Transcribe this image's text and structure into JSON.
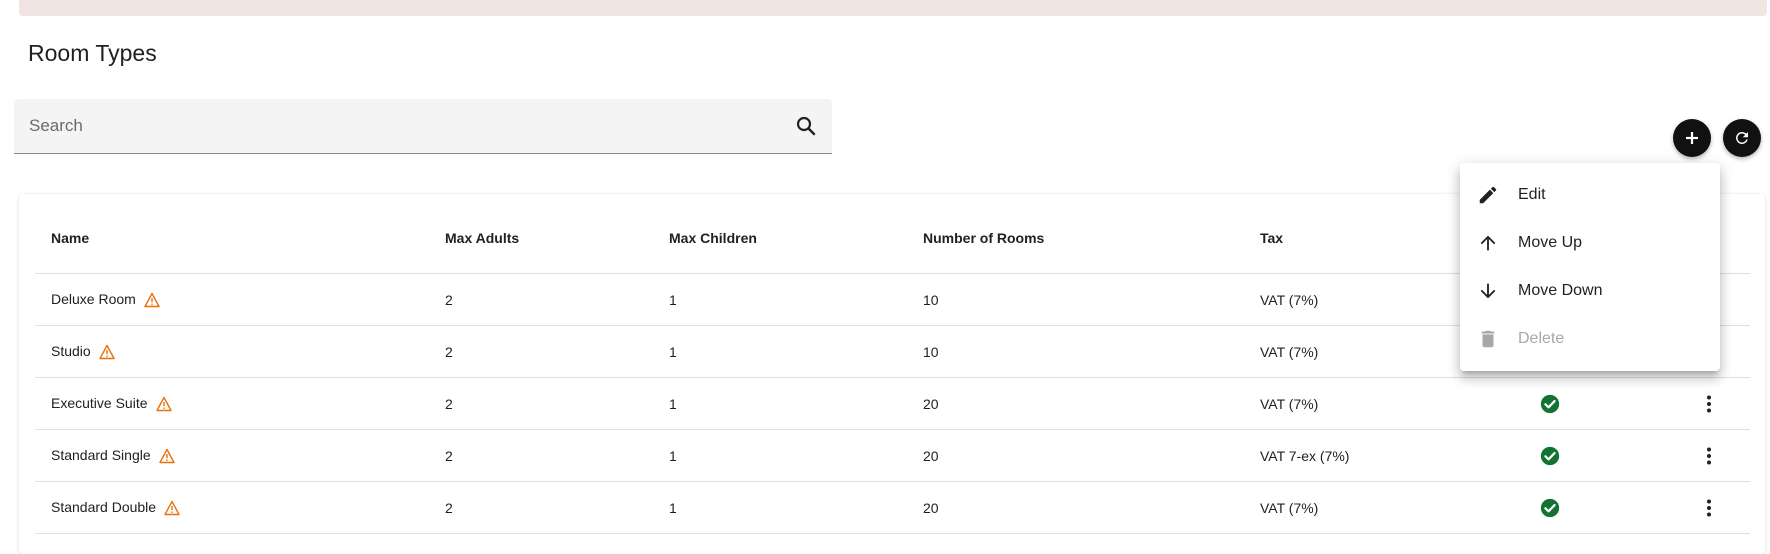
{
  "page": {
    "title": "Room Types"
  },
  "search": {
    "placeholder": "Search",
    "value": ""
  },
  "table": {
    "headers": {
      "name": "Name",
      "max_adults": "Max Adults",
      "max_children": "Max Children",
      "number_of_rooms": "Number of Rooms",
      "tax": "Tax"
    },
    "rows": [
      {
        "name": "Deluxe Room",
        "max_adults": "2",
        "max_children": "1",
        "number_of_rooms": "10",
        "tax": "VAT (7%)",
        "active": true
      },
      {
        "name": "Studio",
        "max_adults": "2",
        "max_children": "1",
        "number_of_rooms": "10",
        "tax": "VAT (7%)",
        "active": true
      },
      {
        "name": "Executive Suite",
        "max_adults": "2",
        "max_children": "1",
        "number_of_rooms": "20",
        "tax": "VAT (7%)",
        "active": true
      },
      {
        "name": "Standard Single",
        "max_adults": "2",
        "max_children": "1",
        "number_of_rooms": "20",
        "tax": "VAT 7-ex (7%)",
        "active": true
      },
      {
        "name": "Standard Double",
        "max_adults": "2",
        "max_children": "1",
        "number_of_rooms": "20",
        "tax": "VAT (7%)",
        "active": true
      }
    ]
  },
  "context_menu": {
    "items": [
      {
        "label": "Edit",
        "icon": "pencil-icon",
        "disabled": false
      },
      {
        "label": "Move Up",
        "icon": "arrow-up-icon",
        "disabled": false
      },
      {
        "label": "Move Down",
        "icon": "arrow-down-icon",
        "disabled": false
      },
      {
        "label": "Delete",
        "icon": "trash-icon",
        "disabled": true
      }
    ]
  },
  "icons": {
    "search": "search-icon",
    "add": "plus-icon",
    "refresh": "refresh-icon",
    "warning": "warning-triangle-icon",
    "status": "check-circle-icon",
    "row_menu": "more-vertical-icon"
  },
  "colors": {
    "banner": "#f0e5e3",
    "fab": "#111111",
    "check": "#137333",
    "warning": "#e8710a",
    "disabled": "#a8a8a8"
  }
}
